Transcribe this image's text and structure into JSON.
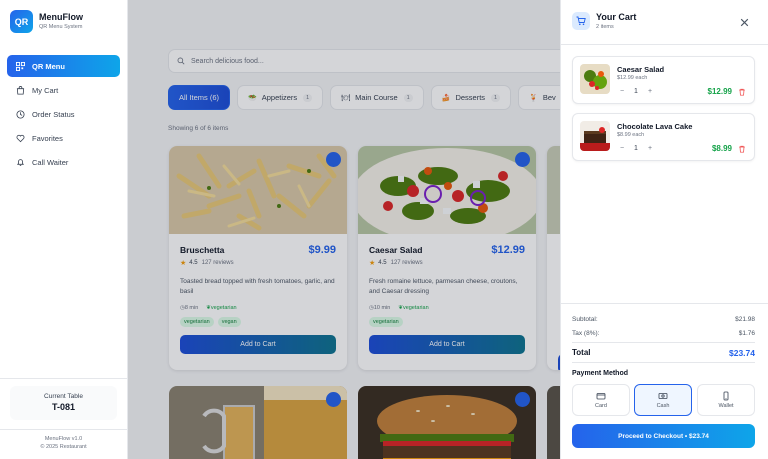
{
  "brand": {
    "logo": "QR",
    "name": "MenuFlow",
    "subtitle": "QR Menu System"
  },
  "nav": [
    {
      "label": "QR Menu",
      "icon": "qr-icon",
      "active": true
    },
    {
      "label": "My Cart",
      "icon": "bag-icon"
    },
    {
      "label": "Order Status",
      "icon": "clock-icon"
    },
    {
      "label": "Favorites",
      "icon": "heart-icon"
    },
    {
      "label": "Call Waiter",
      "icon": "bell-icon"
    }
  ],
  "table": {
    "label": "Current Table",
    "value": "T-081"
  },
  "footer": {
    "version": "MenuFlow v1.0",
    "copyright": "© 2025 Restaurant"
  },
  "search": {
    "placeholder": "Search delicious food..."
  },
  "categories": [
    {
      "label": "All Items (6)",
      "active": true
    },
    {
      "label": "Appetizers",
      "emoji": "🥗",
      "count": "1"
    },
    {
      "label": "Main Course",
      "emoji": "🍽",
      "count": "1"
    },
    {
      "label": "Desserts",
      "emoji": "🍰",
      "count": "1"
    },
    {
      "label": "Bev",
      "emoji": "🍹"
    }
  ],
  "showing": "Showing 6 of 6 items",
  "items": [
    {
      "name": "Bruschetta",
      "price": "$9.99",
      "rating": "4.5",
      "reviews": "127 reviews",
      "desc": "Toasted bread topped with fresh tomatoes, garlic, and basil",
      "time": "8 min",
      "diet": "vegetarian",
      "tags": [
        "vegetarian",
        "vegan"
      ],
      "button": "Add to Cart"
    },
    {
      "name": "Caesar Salad",
      "price": "$12.99",
      "rating": "4.5",
      "reviews": "127 reviews",
      "desc": "Fresh romaine lettuce, parmesan cheese, croutons, and Caesar dressing",
      "time": "10 min",
      "diet": "vegetarian",
      "tags": [
        "vegetarian"
      ],
      "button": "Add to Cart"
    }
  ],
  "cart": {
    "title": "Your Cart",
    "count": "2 items",
    "items": [
      {
        "name": "Caesar Salad",
        "each": "$12.99 each",
        "qty": "1",
        "price": "$12.99"
      },
      {
        "name": "Chocolate Lava Cake",
        "each": "$8.99 each",
        "qty": "1",
        "price": "$8.99"
      }
    ],
    "subtotal_label": "Subtotal:",
    "subtotal": "$21.98",
    "tax_label": "Tax (8%):",
    "tax": "$1.76",
    "total_label": "Total",
    "total": "$23.74",
    "payment_label": "Payment Method",
    "payments": [
      {
        "label": "Card",
        "icon": "card-icon"
      },
      {
        "label": "Cash",
        "icon": "cash-icon",
        "selected": true
      },
      {
        "label": "Wallet",
        "icon": "wallet-icon"
      }
    ],
    "checkout": "Proceed to Checkout • $23.74"
  },
  "colors": {
    "accent": "#2563eb",
    "accent2": "#0ea5e9",
    "price_green": "#16a34a"
  }
}
